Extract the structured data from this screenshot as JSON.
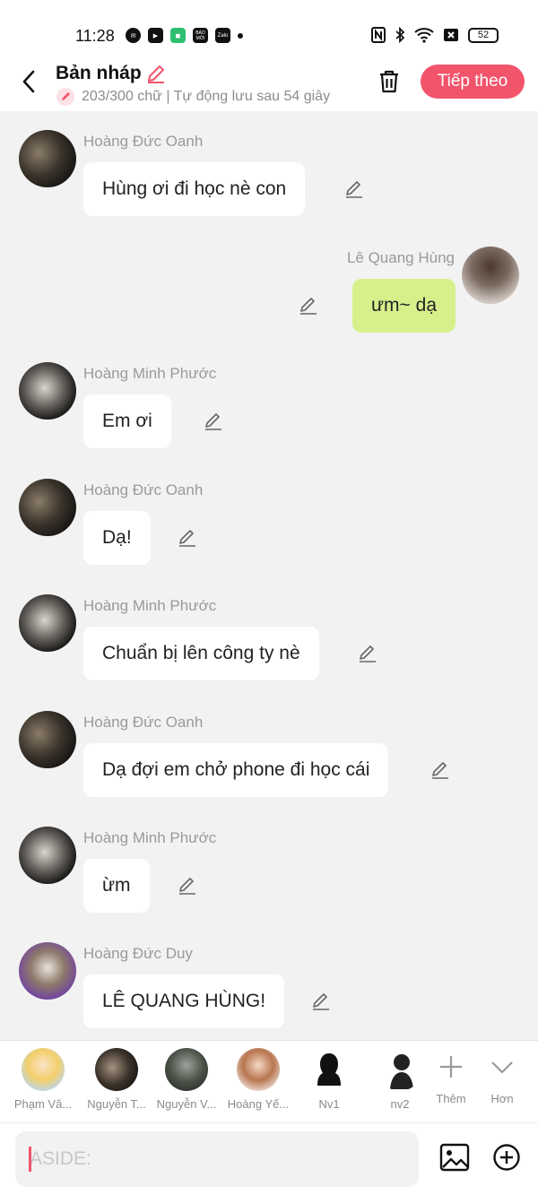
{
  "status_bar": {
    "time": "11:28",
    "battery": "52",
    "app_icons": [
      "messenger-icon",
      "youtube-icon",
      "shopee-icon",
      "bao-moi-icon",
      "zalo-icon"
    ],
    "app_icon_texts": {
      "bao_moi": "BÁO MỚI",
      "zalo": "Zalo"
    }
  },
  "header": {
    "title": "Bản nháp",
    "subtitle": "203/300 chữ | Tự động lưu sau 54 giây",
    "next_label": "Tiếp theo"
  },
  "messages": [
    {
      "sender": "Hoàng Đức Oanh",
      "text": "Hùng ơi đi học nè con",
      "side": "left",
      "avatar": "dark"
    },
    {
      "sender": "Lê Quang Hùng",
      "text": "ưm~ dạ",
      "side": "right",
      "avatar": "hung"
    },
    {
      "sender": "Hoàng Minh Phước",
      "text": "Em ơi",
      "side": "left",
      "avatar": "dark2"
    },
    {
      "sender": "Hoàng Đức Oanh",
      "text": "Dạ!",
      "side": "left",
      "avatar": "dark"
    },
    {
      "sender": "Hoàng Minh Phước",
      "text": "Chuẩn bị lên công ty nè",
      "side": "left",
      "avatar": "dark2"
    },
    {
      "sender": "Hoàng Đức Oanh",
      "text": "Dạ đợi em chở phone đi học cái",
      "side": "left",
      "avatar": "dark"
    },
    {
      "sender": "Hoàng Minh Phước",
      "text": "ừm",
      "side": "left",
      "avatar": "dark2"
    },
    {
      "sender": "Hoàng Đức Duy",
      "text": "LÊ QUANG HÙNG!",
      "side": "left",
      "avatar": "duy"
    }
  ],
  "characters": [
    {
      "label": "Phạm Vă..."
    },
    {
      "label": "Nguyễn T..."
    },
    {
      "label": "Nguyễn V..."
    },
    {
      "label": "Hoàng Yế..."
    },
    {
      "label": "Nv1"
    },
    {
      "label": "nv2"
    }
  ],
  "controls": {
    "add_label": "Thêm",
    "more_label": "Hơn"
  },
  "input": {
    "placeholder": "ASIDE:",
    "value": ""
  },
  "colors": {
    "accent": "#f2546b",
    "mine_bubble": "#d7f08c",
    "background": "#f2f2f2"
  }
}
